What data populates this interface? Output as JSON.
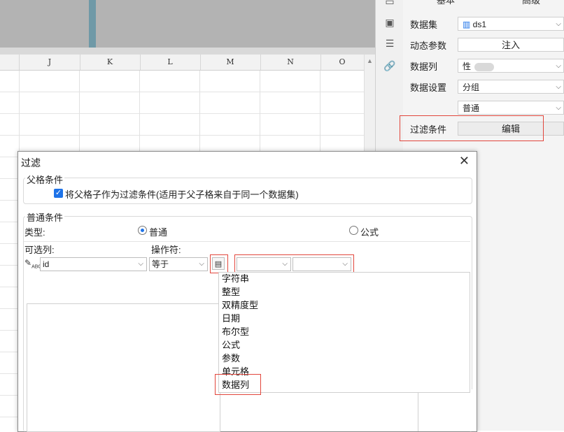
{
  "sheet": {
    "columns": [
      "J",
      "K",
      "L",
      "M",
      "N",
      "O"
    ]
  },
  "panel": {
    "tabs": [
      "基本",
      "高级"
    ],
    "dataset_label": "数据集",
    "dataset_value": "ds1",
    "dynamic_param_label": "动态参数",
    "inject_button": "注入",
    "data_column_label": "数据列",
    "data_column_value": "性",
    "data_setting_label": "数据设置",
    "data_setting_value": "分组",
    "data_setting_sub": "普通",
    "filter_label": "过滤条件",
    "edit_button": "编辑"
  },
  "dialog": {
    "title": "过滤",
    "parent_group_title": "父格条件",
    "parent_checkbox_label": "将父格子作为过滤条件(适用于父子格来自于同一个数据集)",
    "normal_group_title": "普通条件",
    "type_label": "类型:",
    "type_normal": "普通",
    "type_formula": "公式",
    "column_label": "可选列:",
    "operator_label": "操作符:",
    "column_value": "id",
    "operator_value": "等于",
    "value_type_options": [
      "字符串",
      "整型",
      "双精度型",
      "日期",
      "布尔型",
      "公式",
      "参数",
      "单元格",
      "数据列"
    ]
  },
  "colors": {
    "accent": "#1e73e8",
    "highlight": "#e2463c"
  }
}
